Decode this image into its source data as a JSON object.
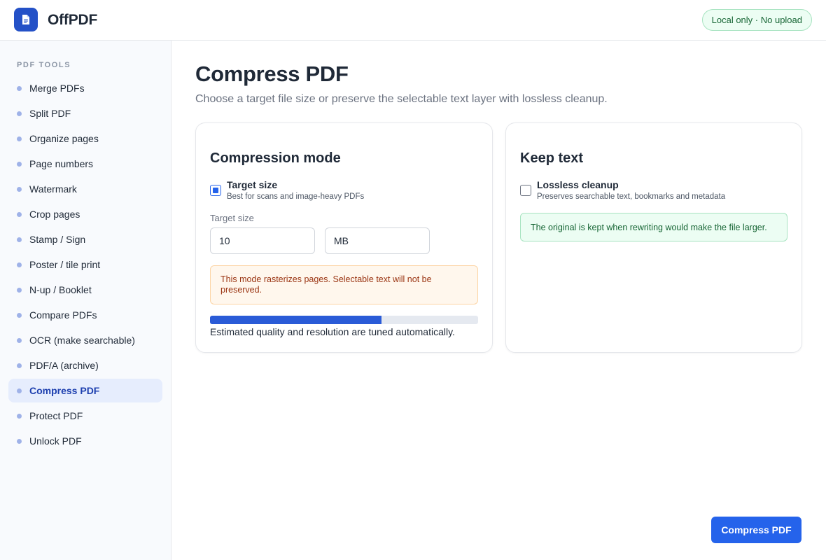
{
  "header": {
    "app_name": "OffPDF",
    "badge": "Local only · No upload"
  },
  "sidebar": {
    "heading": "PDF TOOLS",
    "items": [
      {
        "label": "Merge PDFs",
        "active": false
      },
      {
        "label": "Split PDF",
        "active": false
      },
      {
        "label": "Organize pages",
        "active": false
      },
      {
        "label": "Page numbers",
        "active": false
      },
      {
        "label": "Watermark",
        "active": false
      },
      {
        "label": "Crop pages",
        "active": false
      },
      {
        "label": "Stamp / Sign",
        "active": false
      },
      {
        "label": "Poster / tile print",
        "active": false
      },
      {
        "label": "N-up / Booklet",
        "active": false
      },
      {
        "label": "Compare PDFs",
        "active": false
      },
      {
        "label": "OCR (make searchable)",
        "active": false
      },
      {
        "label": "PDF/A (archive)",
        "active": false
      },
      {
        "label": "Compress PDF",
        "active": true
      },
      {
        "label": "Protect PDF",
        "active": false
      },
      {
        "label": "Unlock PDF",
        "active": false
      }
    ]
  },
  "main": {
    "title": "Compress PDF",
    "subtitle": "Choose a target file size or preserve the selectable text layer with lossless cleanup.",
    "compression_card": {
      "title": "Compression mode",
      "option_title": "Target size",
      "option_desc": "Best for scans and image-heavy PDFs",
      "option_checked": true,
      "field_label": "Target size",
      "size_value": "10",
      "unit_value": "MB",
      "warning": "This mode rasterizes pages. Selectable text will not be preserved.",
      "progress": 0.64,
      "progress_note": "Estimated quality and resolution are tuned automatically."
    },
    "keep_text_card": {
      "title": "Keep text",
      "option_title": "Lossless cleanup",
      "option_desc": "Preserves searchable text, bookmarks and metadata",
      "option_checked": false,
      "info": "The original is kept when rewriting would make the file larger."
    },
    "action_label": "Compress PDF"
  },
  "colors": {
    "accent": "#2563eb",
    "logo": "#2451c7",
    "success_bg": "#ecfdf3",
    "warning_bg": "#fff7ed"
  }
}
